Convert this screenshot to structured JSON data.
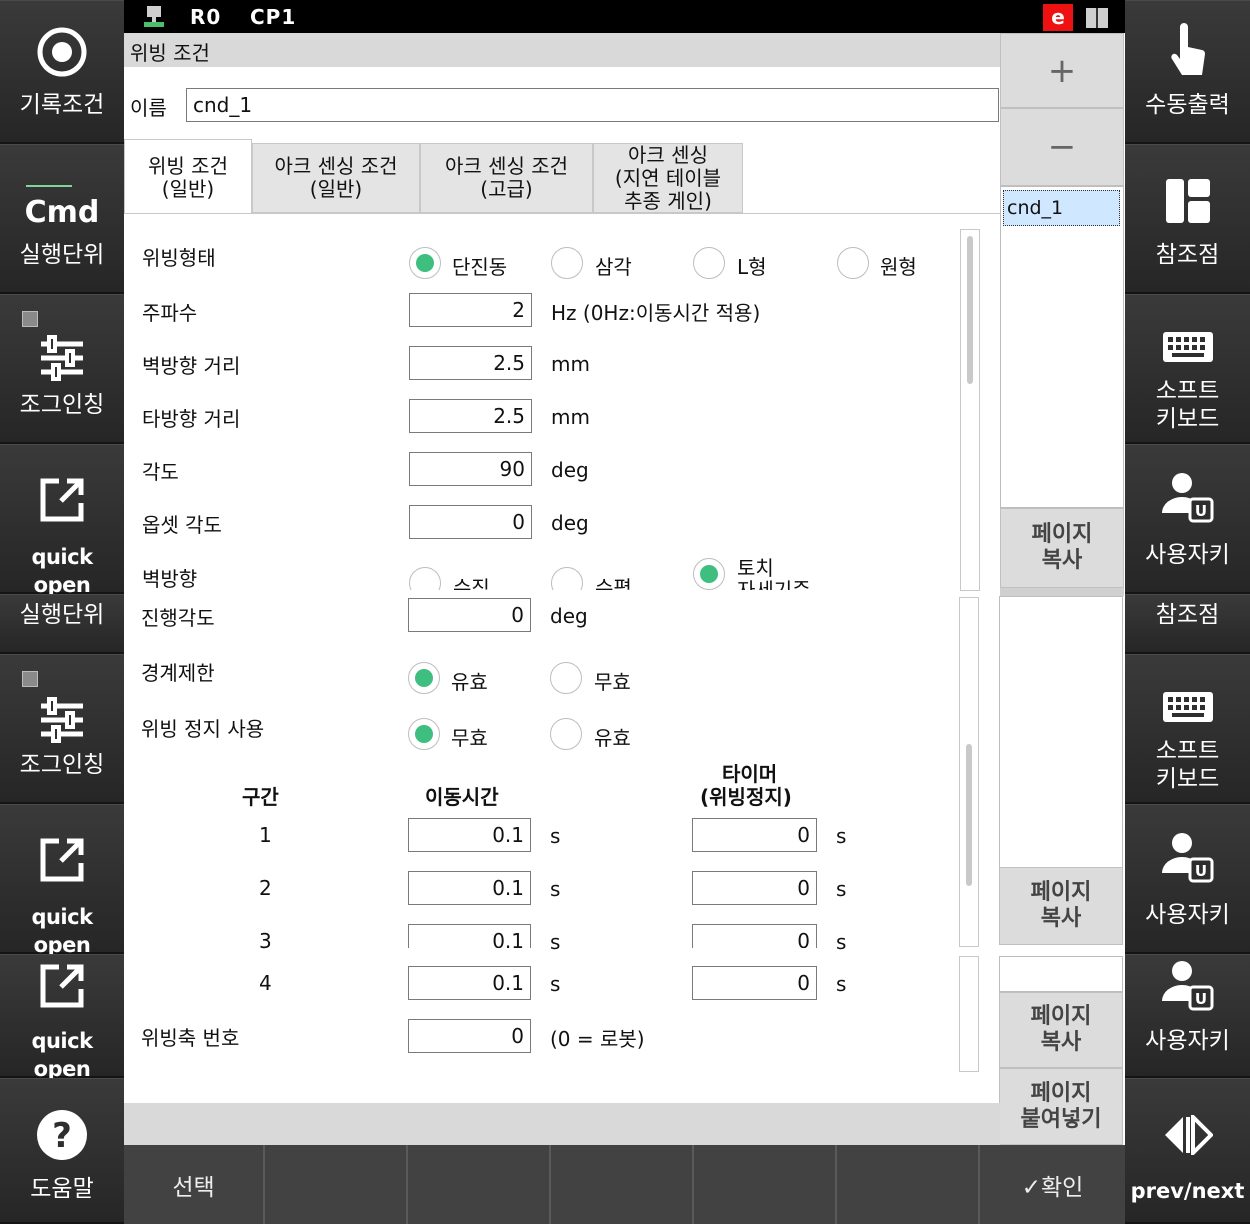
{
  "status": {
    "robot": "R0",
    "program": "CP1",
    "badge": "e"
  },
  "title": "위빙 조건",
  "name_label": "이름",
  "name_value": "cnd_1",
  "tabs": [
    {
      "line1": "위빙 조건",
      "line2": "(일반)"
    },
    {
      "line1": "아크 센싱 조건",
      "line2": "(일반)"
    },
    {
      "line1": "아크 센싱 조건",
      "line2": "(고급)"
    },
    {
      "line1": "아크 센싱",
      "line2": "(지연 테이블",
      "line3": "추종 게인)"
    }
  ],
  "form": {
    "weave_type_label": "위빙형태",
    "weave_types": [
      "단진동",
      "삼각",
      "L형",
      "원형"
    ],
    "freq_label": "주파수",
    "freq_value": "2",
    "freq_unit": "Hz (0Hz:이동시간 적용)",
    "wall_dist_label": "벽방향 거리",
    "wall_dist_value": "2.5",
    "wall_dist_unit": "mm",
    "other_dist_label": "타방향 거리",
    "other_dist_value": "2.5",
    "other_dist_unit": "mm",
    "angle_label": "각도",
    "angle_value": "90",
    "angle_unit": "deg",
    "offset_label": "옵셋 각도",
    "offset_value": "0",
    "offset_unit": "deg",
    "wall_dir_label": "벽방향",
    "wall_dir_options": [
      "수직",
      "수평",
      "토치",
      "자세기준"
    ],
    "travel_angle_label": "진행각도",
    "travel_angle_value": "0",
    "travel_angle_unit": "deg",
    "limit_label": "경계제한",
    "limit_options": [
      "유효",
      "무효"
    ],
    "stop_label": "위빙 정지 사용",
    "stop_options": [
      "무효",
      "유효"
    ],
    "table_headers": {
      "section": "구간",
      "move_time": "이동시간",
      "timer_line1": "타이머",
      "timer_line2": "(위빙정지)"
    },
    "rows": [
      {
        "n": "1",
        "move": "0.1",
        "move_unit": "s",
        "timer": "0",
        "timer_unit": "s"
      },
      {
        "n": "2",
        "move": "0.1",
        "move_unit": "s",
        "timer": "0",
        "timer_unit": "s"
      },
      {
        "n": "3",
        "move": "0.1",
        "move_unit": "s",
        "timer": "0",
        "timer_unit": "s"
      },
      {
        "n": "4",
        "move": "0.1",
        "move_unit": "s",
        "timer": "0",
        "timer_unit": "s"
      }
    ],
    "axis_label": "위빙축 번호",
    "axis_value": "0",
    "axis_note": "(0 = 로봇)"
  },
  "list": {
    "add": "+",
    "remove": "−",
    "items": [
      "cnd_1"
    ]
  },
  "page_buttons": {
    "copy": "페이지\n복사",
    "copy2": "페이지\n복사",
    "copy3": "페이지\n복사",
    "paste": "페이지\n붙여넣기"
  },
  "left_buttons": {
    "record": "기록조건",
    "cmd": "Cmd",
    "exec_unit": "실행단위",
    "jog": "조그인칭",
    "quick_open": "quick open",
    "exec_unit2": "실행단위",
    "jog2": "조그인칭",
    "quick_open2": "quick open",
    "quick_open3": "quick open",
    "help": "도움말"
  },
  "right_buttons": {
    "manual_out": "수동출력",
    "ref_point": "참조점",
    "soft_kb_1": "소프트",
    "soft_kb_2": "키보드",
    "user_key": "사용자키",
    "ref_point2": "참조점",
    "soft_kb2_1": "소프트",
    "soft_kb2_2": "키보드",
    "user_key2": "사용자키",
    "user_key3": "사용자키",
    "prevnext": "prev/next"
  },
  "bottom": {
    "select": "선택",
    "confirm": "✓확인"
  },
  "colors": {
    "radio_on": "#3fbf7f",
    "side_bg": "#2e2e2e",
    "list_selected": "#cfe8ff"
  }
}
